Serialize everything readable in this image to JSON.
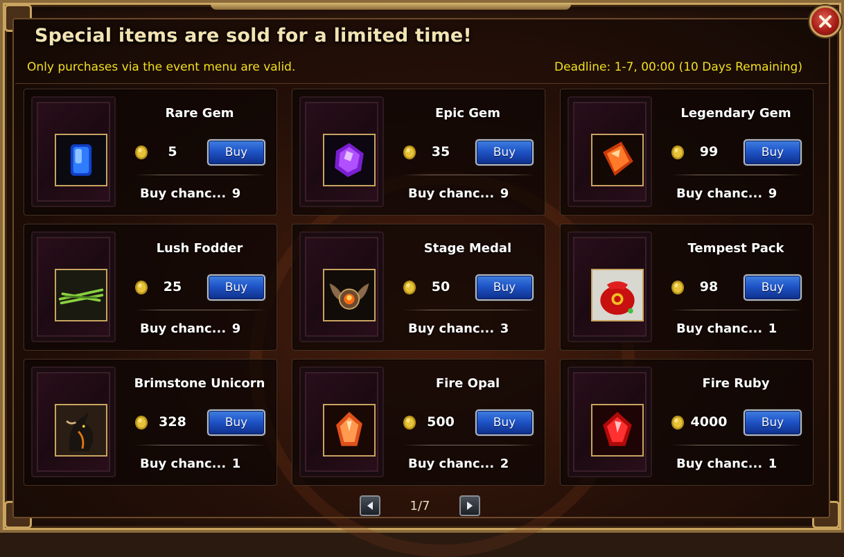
{
  "header": {
    "title": "Special items are sold for a limited time!",
    "note": "Only purchases via the event menu are valid.",
    "deadline": "Deadline: 1-7, 00:00 (10 Days Remaining)"
  },
  "icons": {
    "close": "close-icon",
    "currency": "coin-icon",
    "prev": "arrow-left-icon",
    "next": "arrow-right-icon"
  },
  "buy_label": "Buy",
  "chance_label": "Buy chanc...",
  "items": [
    {
      "name": "Rare Gem",
      "price": "5",
      "chances": "9",
      "icon": "blue-gem-icon"
    },
    {
      "name": "Epic Gem",
      "price": "35",
      "chances": "9",
      "icon": "purple-gem-icon"
    },
    {
      "name": "Legendary Gem",
      "price": "99",
      "chances": "9",
      "icon": "orange-gem-icon"
    },
    {
      "name": "Lush Fodder",
      "price": "25",
      "chances": "9",
      "icon": "fodder-icon"
    },
    {
      "name": "Stage Medal",
      "price": "50",
      "chances": "3",
      "icon": "medal-icon"
    },
    {
      "name": "Tempest Pack",
      "price": "98",
      "chances": "1",
      "icon": "red-pouch-icon"
    },
    {
      "name": "Brimstone Unicorn",
      "price": "328",
      "chances": "1",
      "icon": "unicorn-icon"
    },
    {
      "name": "Fire Opal",
      "price": "500",
      "chances": "2",
      "icon": "fire-opal-icon"
    },
    {
      "name": "Fire Ruby",
      "price": "4000",
      "chances": "1",
      "icon": "fire-ruby-icon"
    }
  ],
  "pagination": {
    "text": "1/7"
  },
  "colors": {
    "title": "#f3e3b2",
    "note": "#f0e020",
    "buy_button": "#1f55c8",
    "frame_gold": "#c9a560"
  }
}
